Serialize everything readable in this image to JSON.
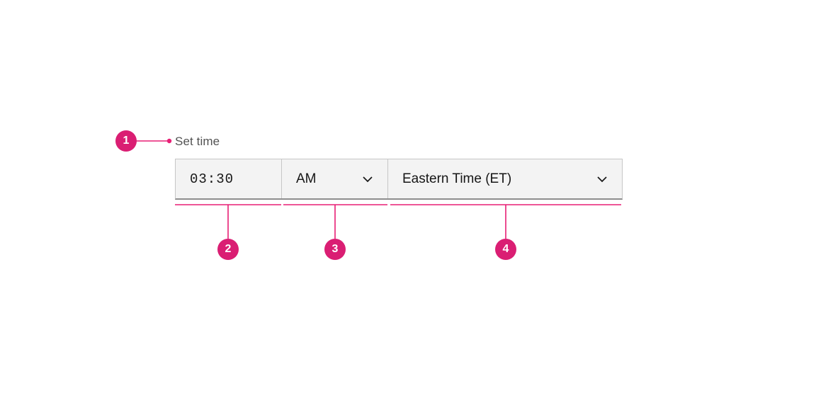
{
  "label": "Set time",
  "time": {
    "value": "03:30"
  },
  "ampm": {
    "value": "AM"
  },
  "timezone": {
    "value": "Eastern Time (ET)"
  },
  "annotations": {
    "a1": "1",
    "a2": "2",
    "a3": "3",
    "a4": "4"
  }
}
